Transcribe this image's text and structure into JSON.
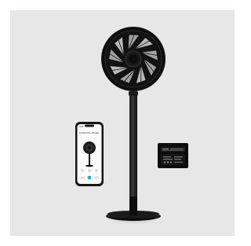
{
  "image": {
    "background_color": "#ffffff",
    "panel_color": "#e7e7e7",
    "product_color": "#111111"
  },
  "phone_app": {
    "time": "9:41",
    "title": "Control the climate"
  },
  "remote": {
    "icons": [
      "power-icon",
      "speed-icon",
      "timer-icon"
    ]
  }
}
